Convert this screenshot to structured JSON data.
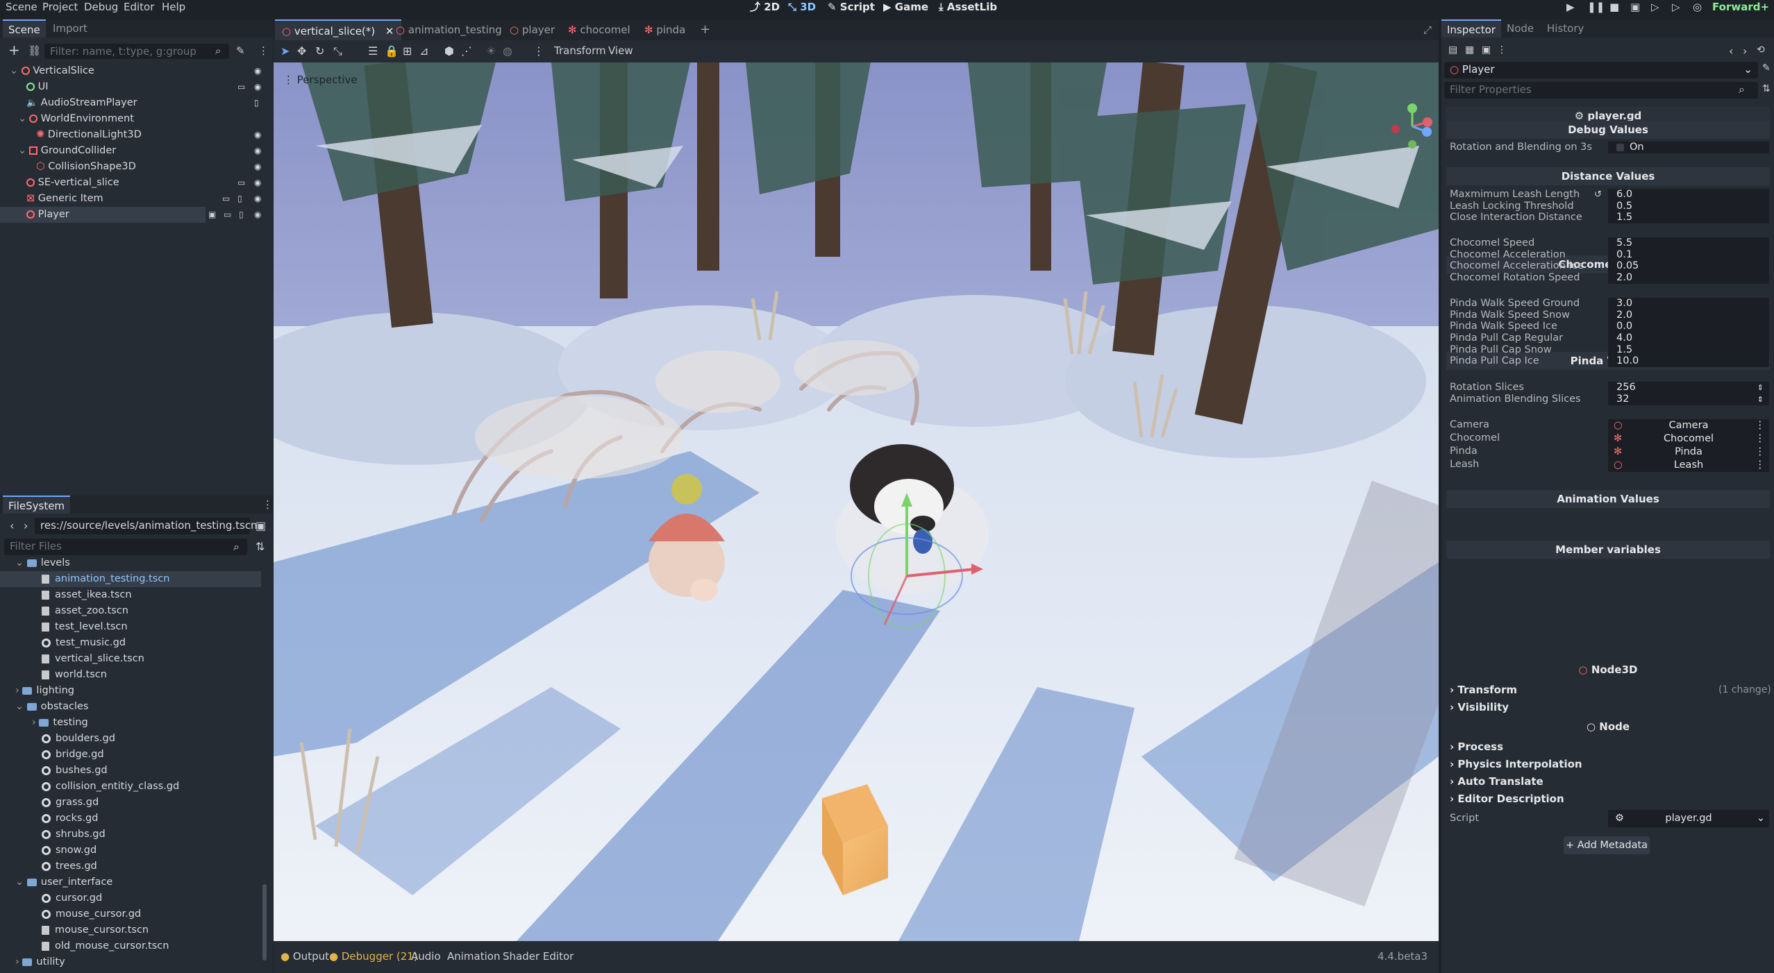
{
  "menu": [
    "Scene",
    "Project",
    "Debug",
    "Editor",
    "Help"
  ],
  "workspaces": [
    "2D",
    "3D",
    "Script",
    "Game",
    "AssetLib"
  ],
  "renderer": "Forward+",
  "scene_dock": {
    "tabs": [
      "Scene",
      "Import"
    ],
    "filter_placeholder": "Filter: name, t:type, g:group",
    "nodes": [
      {
        "name": "VerticalSlice",
        "depth": 0,
        "color": "#ff6b6b"
      },
      {
        "name": "UI",
        "depth": 1,
        "color": "#8eef97"
      },
      {
        "name": "AudioStreamPlayer",
        "depth": 1,
        "color": "#c7c9cc"
      },
      {
        "name": "WorldEnvironment",
        "depth": 1,
        "color": "#ff6b6b"
      },
      {
        "name": "DirectionalLight3D",
        "depth": 2,
        "color": "#ff6b6b"
      },
      {
        "name": "GroundCollider",
        "depth": 1,
        "color": "#ff6b6b"
      },
      {
        "name": "CollisionShape3D",
        "depth": 2,
        "color": "#ff6b6b"
      },
      {
        "name": "SE-vertical_slice",
        "depth": 1,
        "color": "#ff6b6b"
      },
      {
        "name": "Generic Item",
        "depth": 1,
        "color": "#ff6b6b"
      },
      {
        "name": "Player",
        "depth": 1,
        "color": "#ff6b6b"
      }
    ]
  },
  "filesystem": {
    "title": "FileSystem",
    "path": "res://source/levels/animation_testing.tscn",
    "filter_placeholder": "Filter Files",
    "items": [
      {
        "name": "levels",
        "type": "folder",
        "depth": 1
      },
      {
        "name": "animation_testing.tscn",
        "type": "scene",
        "depth": 2,
        "selected": true
      },
      {
        "name": "asset_ikea.tscn",
        "type": "scene",
        "depth": 2
      },
      {
        "name": "asset_zoo.tscn",
        "type": "scene",
        "depth": 2
      },
      {
        "name": "test_level.tscn",
        "type": "scene",
        "depth": 2
      },
      {
        "name": "test_music.gd",
        "type": "script",
        "depth": 2
      },
      {
        "name": "vertical_slice.tscn",
        "type": "scene",
        "depth": 2
      },
      {
        "name": "world.tscn",
        "type": "scene",
        "depth": 2
      },
      {
        "name": "lighting",
        "type": "folder",
        "depth": 1
      },
      {
        "name": "obstacles",
        "type": "folder",
        "depth": 1
      },
      {
        "name": "testing",
        "type": "folder",
        "depth": 2
      },
      {
        "name": "boulders.gd",
        "type": "script",
        "depth": 2
      },
      {
        "name": "bridge.gd",
        "type": "script",
        "depth": 2
      },
      {
        "name": "bushes.gd",
        "type": "script",
        "depth": 2
      },
      {
        "name": "collision_entitiy_class.gd",
        "type": "script",
        "depth": 2
      },
      {
        "name": "grass.gd",
        "type": "script",
        "depth": 2
      },
      {
        "name": "rocks.gd",
        "type": "script",
        "depth": 2
      },
      {
        "name": "shrubs.gd",
        "type": "script",
        "depth": 2
      },
      {
        "name": "snow.gd",
        "type": "script",
        "depth": 2
      },
      {
        "name": "trees.gd",
        "type": "script",
        "depth": 2
      },
      {
        "name": "user_interface",
        "type": "folder",
        "depth": 1
      },
      {
        "name": "cursor.gd",
        "type": "script",
        "depth": 2
      },
      {
        "name": "mouse_cursor.gd",
        "type": "script",
        "depth": 2
      },
      {
        "name": "mouse_cursor.tscn",
        "type": "scene",
        "depth": 2
      },
      {
        "name": "old_mouse_cursor.tscn",
        "type": "scene",
        "depth": 2
      },
      {
        "name": "utility",
        "type": "folder",
        "depth": 1
      }
    ]
  },
  "editor_tabs": [
    "vertical_slice(*)",
    "animation_testing",
    "player",
    "chocomel",
    "pinda"
  ],
  "viewport": {
    "menus": [
      "Transform",
      "View"
    ],
    "label": "Perspective"
  },
  "bottom_panel": {
    "tabs": [
      "Output",
      "Debugger (21)",
      "Audio",
      "Animation",
      "Shader Editor"
    ],
    "version": "4.4.beta3"
  },
  "inspector": {
    "tabs": [
      "Inspector",
      "Node",
      "History"
    ],
    "object": "Player",
    "filter_placeholder": "Filter Properties",
    "script_title": "player.gd",
    "sections": [
      {
        "title": "Debug Values",
        "props": [
          {
            "label": "Rotation and Blending on 3s",
            "value": "On"
          }
        ]
      },
      {
        "title": "Distance Values",
        "props": [
          {
            "label": "Maxmimum Leash Length",
            "value": "6.0"
          },
          {
            "label": "Leash Locking Threshold",
            "value": "0.5"
          },
          {
            "label": "Close Interaction Distance",
            "value": "1.5"
          }
        ]
      },
      {
        "title": "Chocomel Values",
        "props": [
          {
            "label": "Chocomel Speed",
            "value": "5.5"
          },
          {
            "label": "Chocomel Acceleration",
            "value": "0.1"
          },
          {
            "label": "Chocomel Acceleration Ice",
            "value": "0.05"
          },
          {
            "label": "Chocomel Rotation Speed",
            "value": "2.0"
          }
        ]
      },
      {
        "title": "Pinda Values",
        "props": [
          {
            "label": "Pinda Walk Speed Ground",
            "value": "3.0"
          },
          {
            "label": "Pinda Walk Speed Snow",
            "value": "2.0"
          },
          {
            "label": "Pinda Walk Speed Ice",
            "value": "0.0"
          },
          {
            "label": "Pinda Pull Cap Regular",
            "value": "4.0"
          },
          {
            "label": "Pinda Pull Cap Snow",
            "value": "1.5"
          },
          {
            "label": "Pinda Pull Cap Ice",
            "value": "10.0"
          }
        ]
      },
      {
        "title": "Animation Values",
        "props": [
          {
            "label": "Rotation Slices",
            "value": "256"
          },
          {
            "label": "Animation Blending Slices",
            "value": "32"
          }
        ]
      },
      {
        "title": "Member variables",
        "props": [
          {
            "label": "Camera",
            "value": "Camera"
          },
          {
            "label": "Chocomel",
            "value": "Chocomel"
          },
          {
            "label": "Pinda",
            "value": "Pinda"
          },
          {
            "label": "Leash",
            "value": "Leash"
          }
        ]
      }
    ],
    "node3d_title": "Node3D",
    "node3d_groups": [
      "Transform",
      "Visibility"
    ],
    "transform_note": "(1 change)",
    "node_title": "Node",
    "node_groups": [
      "Process",
      "Physics Interpolation",
      "Auto Translate",
      "Editor Description"
    ],
    "script_label": "Script",
    "script_value": "player.gd",
    "add_metadata": "Add Metadata"
  }
}
